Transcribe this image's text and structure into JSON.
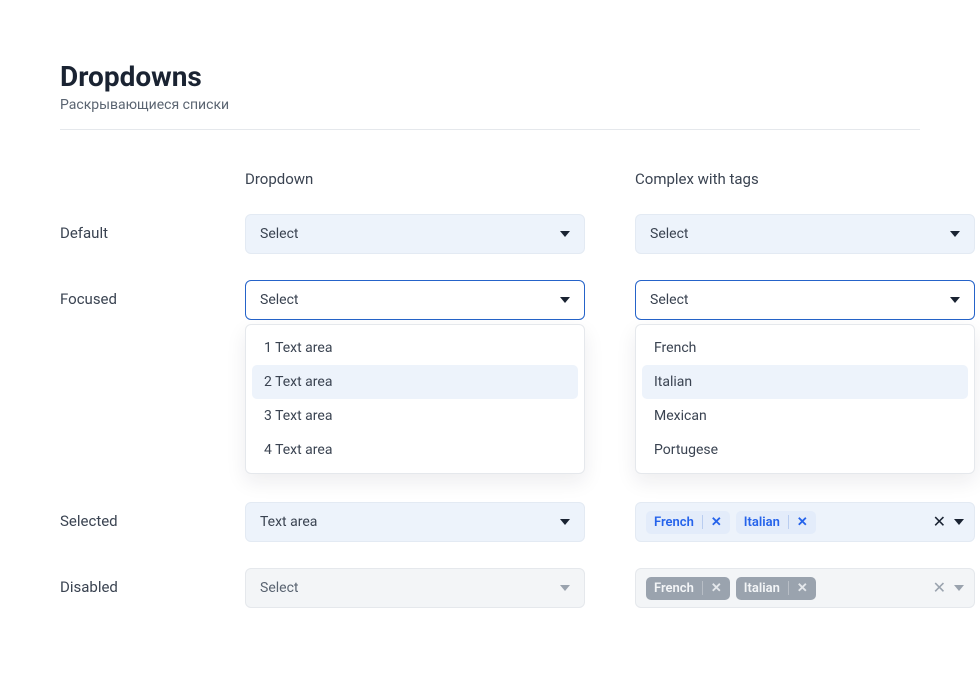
{
  "header": {
    "title": "Dropdowns",
    "subtitle": "Раскрывающиеся списки"
  },
  "columns": {
    "dropdown": "Dropdown",
    "complex": "Complex with tags"
  },
  "rows": {
    "default": "Default",
    "focused": "Focused",
    "selected": "Selected",
    "disabled": "Disabled"
  },
  "placeholder": "Select",
  "dropdown_menu": {
    "items": [
      "1 Text area",
      "2 Text area",
      "3 Text area",
      "4 Text area"
    ],
    "hover_index": 1
  },
  "complex_menu": {
    "items": [
      "French",
      "Italian",
      "Mexican",
      "Portugese"
    ],
    "hover_index": 1
  },
  "selected_value": "Text area",
  "selected_tags": [
    "French",
    "Italian"
  ],
  "disabled_tags": [
    "French",
    "Italian"
  ]
}
